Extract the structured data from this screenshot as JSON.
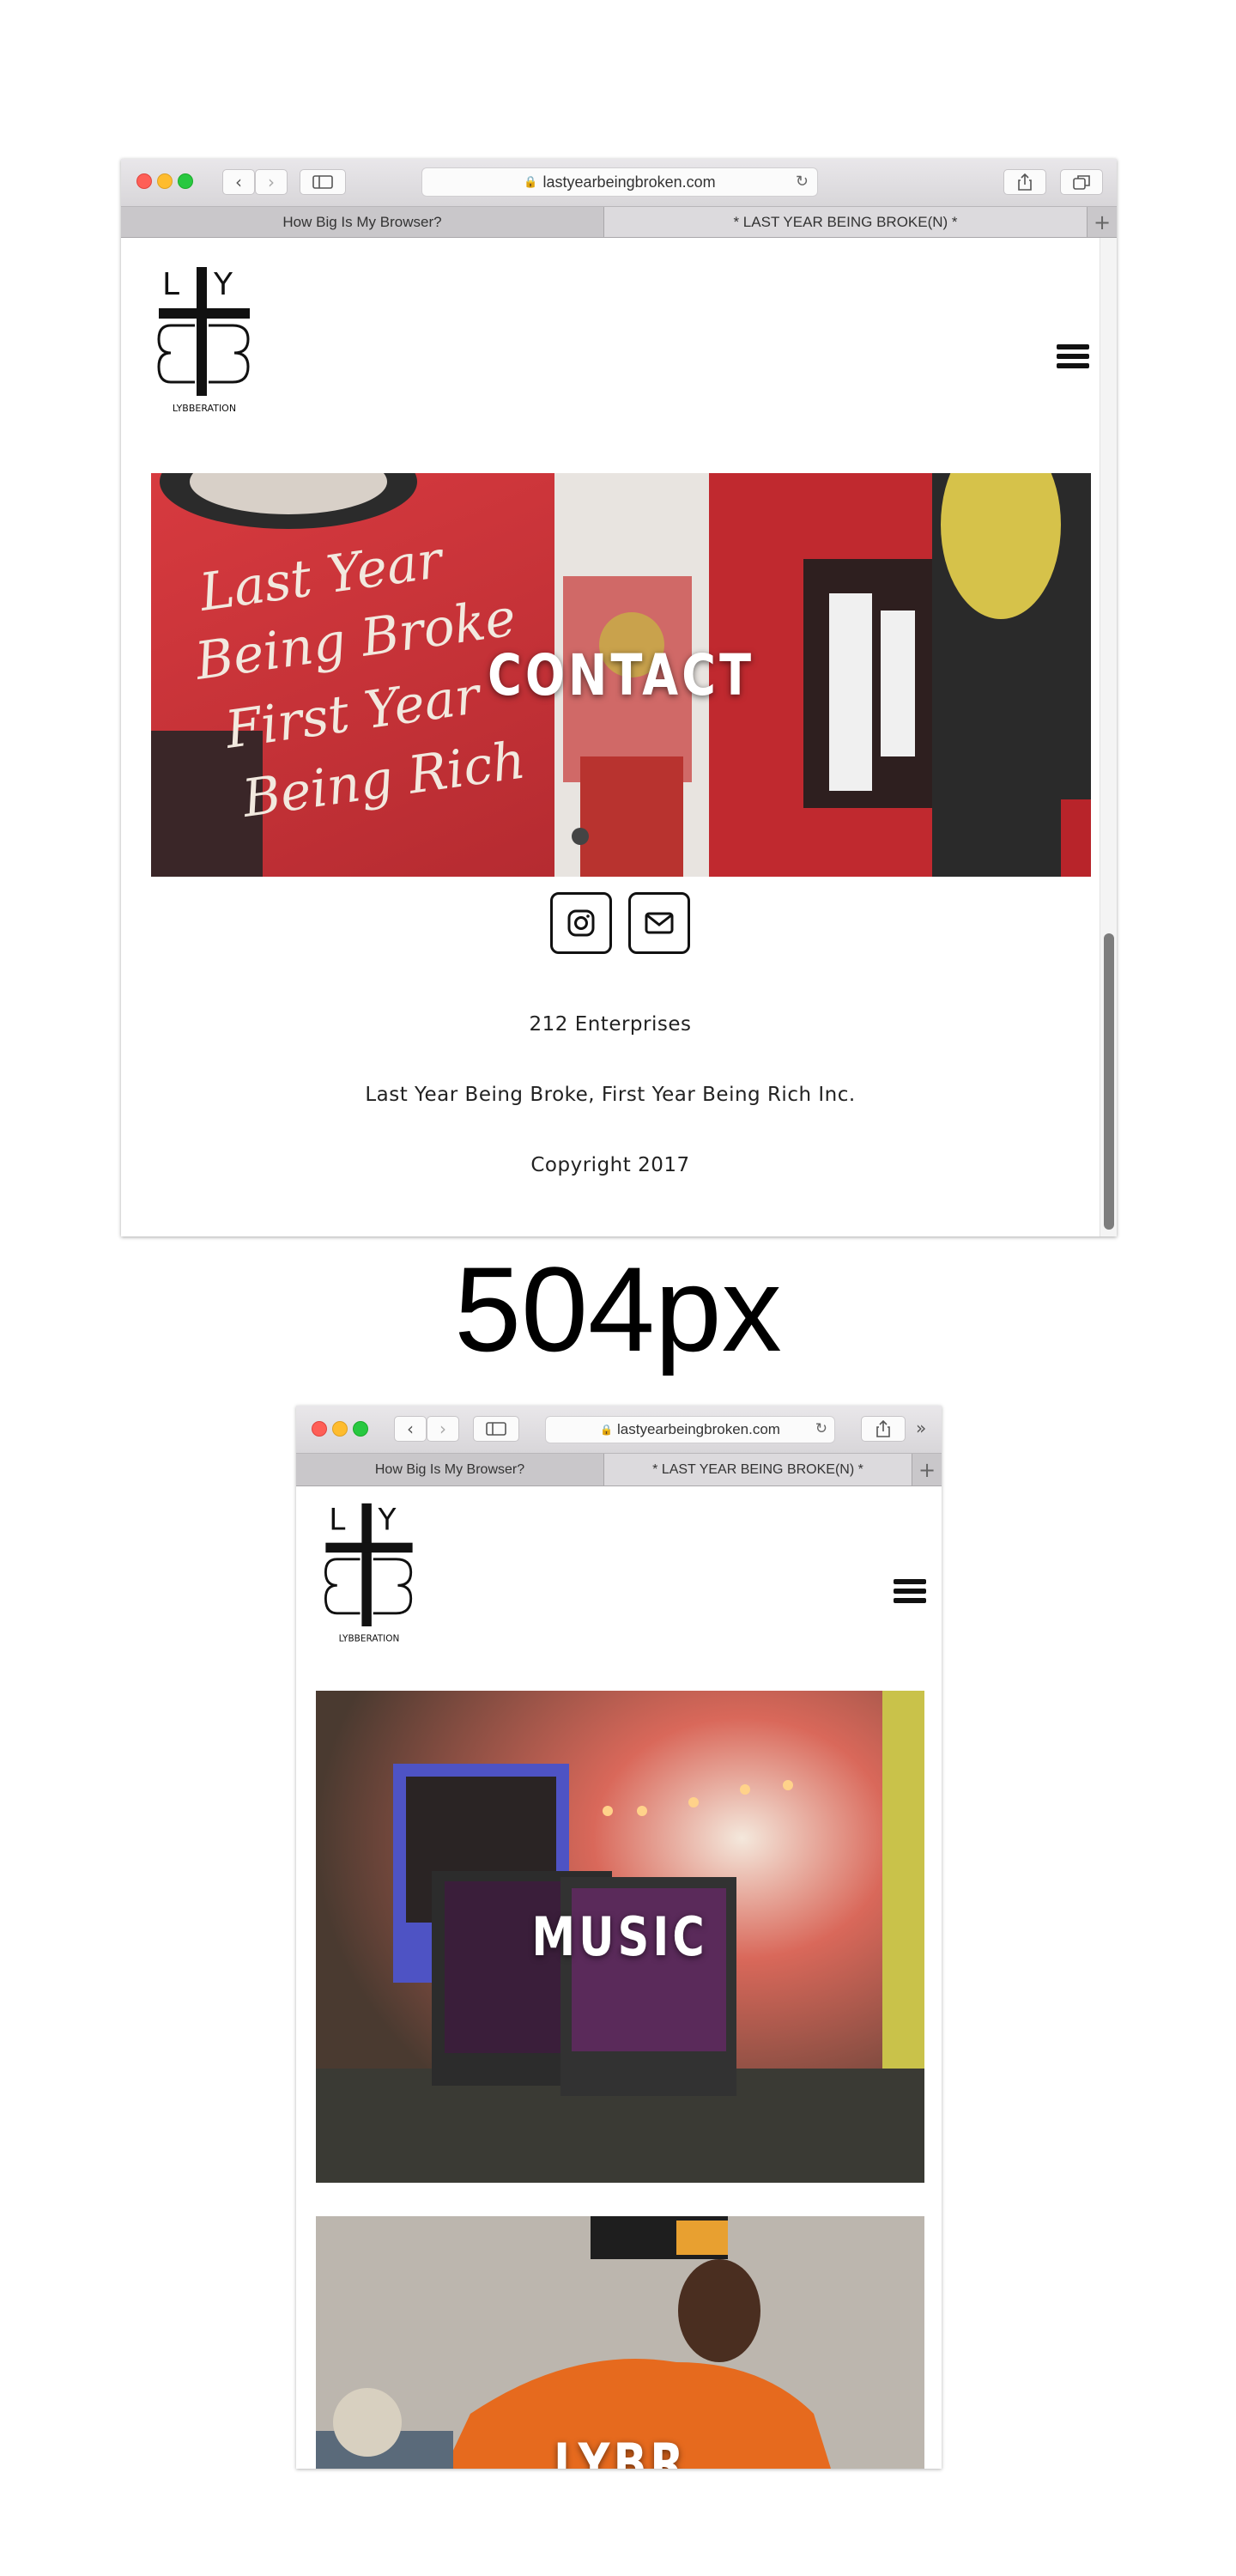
{
  "browser1": {
    "url": "lastyearbeingbroken.com",
    "tabs": [
      {
        "label": "How Big Is My Browser?",
        "active": false
      },
      {
        "label": "* LAST YEAR BEING BROKE(N) *",
        "active": true
      }
    ],
    "site": {
      "logo_caption": "LYBBERATION",
      "hero_title": "CONTACT",
      "footer_lines": [
        "212 Enterprises",
        "Last Year Being Broke, First Year Being Rich Inc.",
        "Copyright 2017"
      ],
      "social": [
        {
          "icon": "instagram-icon"
        },
        {
          "icon": "mail-icon"
        }
      ]
    }
  },
  "size_label": "504px",
  "browser2": {
    "url": "lastyearbeingbroken.com",
    "tabs": [
      {
        "label": "How Big Is My Browser?",
        "active": false
      },
      {
        "label": "* LAST YEAR BEING BROKE(N) *",
        "active": true
      }
    ],
    "site": {
      "logo_caption": "LYBBERATION",
      "hero1_title": "MUSIC",
      "hero2_title": "LYBR"
    }
  },
  "colors": {
    "accent_red": "#d9363c",
    "text_dark": "#222222"
  }
}
